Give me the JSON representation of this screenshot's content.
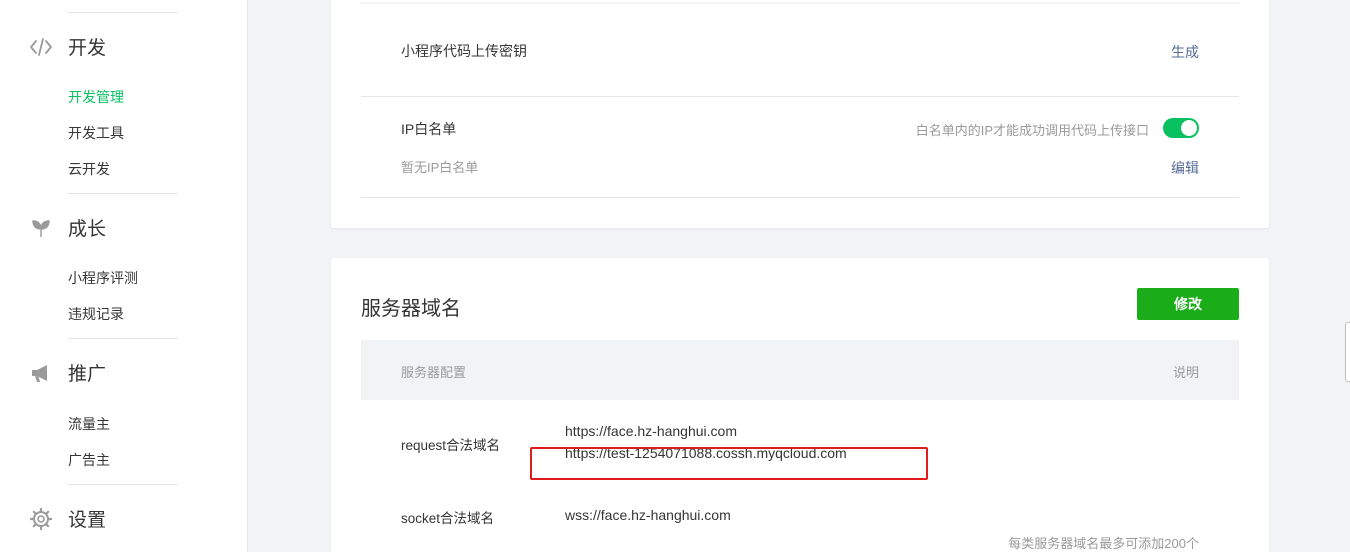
{
  "sidebar": {
    "sections": [
      {
        "icon": "code-icon",
        "title": "开发",
        "items": [
          "开发管理",
          "开发工具",
          "云开发"
        ],
        "active_index": 0
      },
      {
        "icon": "sprout-icon",
        "title": "成长",
        "items": [
          "小程序评测",
          "违规记录"
        ]
      },
      {
        "icon": "megaphone-icon",
        "title": "推广",
        "items": [
          "流量主",
          "广告主"
        ]
      },
      {
        "icon": "gear-icon",
        "title": "设置",
        "items": []
      }
    ]
  },
  "upload_key": {
    "label": "小程序代码上传密钥",
    "action": "生成"
  },
  "ip_whitelist": {
    "label": "IP白名单",
    "hint": "白名单内的IP才能成功调用代码上传接口",
    "toggle_on": true,
    "empty_text": "暂无IP白名单",
    "edit": "编辑"
  },
  "server_domain": {
    "title": "服务器域名",
    "modify_button": "修改",
    "table_header": {
      "config": "服务器配置",
      "desc": "说明"
    },
    "rows": [
      {
        "label": "request合法域名",
        "values": [
          "https://face.hz-hanghui.com",
          "https://test-1254071088.cossh.myqcloud.com"
        ]
      },
      {
        "label": "socket合法域名",
        "values": [
          "wss://face.hz-hanghui.com"
        ]
      }
    ],
    "footnote": "每类服务器域名最多可添加200个"
  },
  "colors": {
    "brand_green": "#07c160",
    "button_green": "#1aad19",
    "link": "#576b95",
    "highlight_red": "#e01b1b"
  }
}
